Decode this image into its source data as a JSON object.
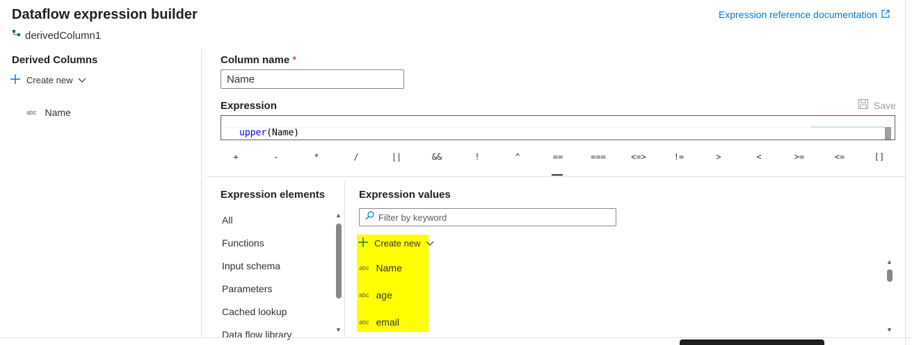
{
  "header": {
    "title": "Dataflow expression builder",
    "subtitle": "derivedColumn1",
    "doc_link": "Expression reference documentation",
    "subtitle_icon": "derived-column-icon",
    "doc_link_icon": "external-link-icon"
  },
  "derived_columns": {
    "title": "Derived Columns",
    "create_new": "Create new",
    "items": [
      {
        "type": "abc",
        "label": "Name"
      }
    ]
  },
  "column": {
    "label": "Column name",
    "required_mark": "*",
    "value": "Name"
  },
  "expression": {
    "label": "Expression",
    "save_label": "Save",
    "code_fn": "upper",
    "code_args": "(Name)"
  },
  "operators": [
    "+",
    "-",
    "*",
    "/",
    "||",
    "&&",
    "!",
    "^",
    "==",
    "===",
    "<=>",
    "!=",
    ">",
    "<",
    ">=",
    "<=",
    "[]"
  ],
  "expression_elements": {
    "title": "Expression elements",
    "items": [
      "All",
      "Functions",
      "Input schema",
      "Parameters",
      "Cached lookup",
      "Data flow library"
    ]
  },
  "expression_values": {
    "title": "Expression values",
    "filter_placeholder": "Filter by keyword",
    "create_new": "Create new",
    "items": [
      {
        "type": "abc",
        "label": "Name"
      },
      {
        "type": "abc",
        "label": "age"
      },
      {
        "type": "abc",
        "label": "email"
      }
    ],
    "highlight_color": "#ffff00"
  },
  "colors": {
    "accent": "#0078d4",
    "required": "#a4262c"
  }
}
